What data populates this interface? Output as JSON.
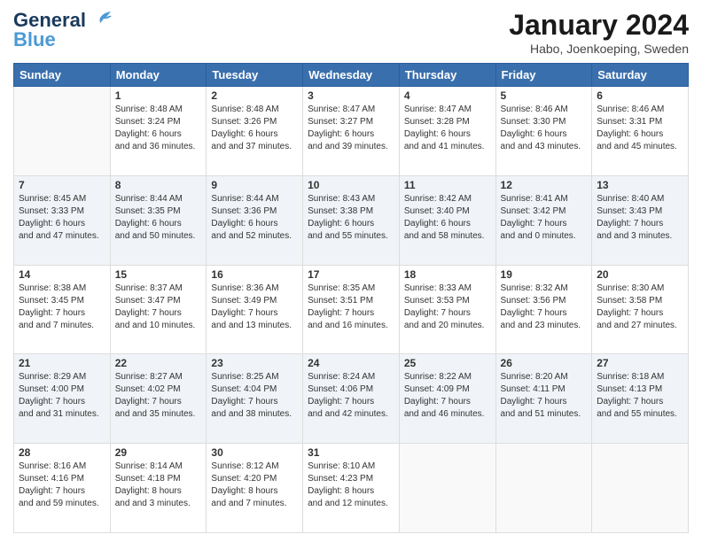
{
  "header": {
    "logo_line1": "General",
    "logo_line2": "Blue",
    "title": "January 2024",
    "subtitle": "Habo, Joenkoeping, Sweden"
  },
  "weekdays": [
    "Sunday",
    "Monday",
    "Tuesday",
    "Wednesday",
    "Thursday",
    "Friday",
    "Saturday"
  ],
  "weeks": [
    [
      {
        "day": "",
        "sunrise": "",
        "sunset": "",
        "daylight": ""
      },
      {
        "day": "1",
        "sunrise": "Sunrise: 8:48 AM",
        "sunset": "Sunset: 3:24 PM",
        "daylight": "Daylight: 6 hours and 36 minutes."
      },
      {
        "day": "2",
        "sunrise": "Sunrise: 8:48 AM",
        "sunset": "Sunset: 3:26 PM",
        "daylight": "Daylight: 6 hours and 37 minutes."
      },
      {
        "day": "3",
        "sunrise": "Sunrise: 8:47 AM",
        "sunset": "Sunset: 3:27 PM",
        "daylight": "Daylight: 6 hours and 39 minutes."
      },
      {
        "day": "4",
        "sunrise": "Sunrise: 8:47 AM",
        "sunset": "Sunset: 3:28 PM",
        "daylight": "Daylight: 6 hours and 41 minutes."
      },
      {
        "day": "5",
        "sunrise": "Sunrise: 8:46 AM",
        "sunset": "Sunset: 3:30 PM",
        "daylight": "Daylight: 6 hours and 43 minutes."
      },
      {
        "day": "6",
        "sunrise": "Sunrise: 8:46 AM",
        "sunset": "Sunset: 3:31 PM",
        "daylight": "Daylight: 6 hours and 45 minutes."
      }
    ],
    [
      {
        "day": "7",
        "sunrise": "Sunrise: 8:45 AM",
        "sunset": "Sunset: 3:33 PM",
        "daylight": "Daylight: 6 hours and 47 minutes."
      },
      {
        "day": "8",
        "sunrise": "Sunrise: 8:44 AM",
        "sunset": "Sunset: 3:35 PM",
        "daylight": "Daylight: 6 hours and 50 minutes."
      },
      {
        "day": "9",
        "sunrise": "Sunrise: 8:44 AM",
        "sunset": "Sunset: 3:36 PM",
        "daylight": "Daylight: 6 hours and 52 minutes."
      },
      {
        "day": "10",
        "sunrise": "Sunrise: 8:43 AM",
        "sunset": "Sunset: 3:38 PM",
        "daylight": "Daylight: 6 hours and 55 minutes."
      },
      {
        "day": "11",
        "sunrise": "Sunrise: 8:42 AM",
        "sunset": "Sunset: 3:40 PM",
        "daylight": "Daylight: 6 hours and 58 minutes."
      },
      {
        "day": "12",
        "sunrise": "Sunrise: 8:41 AM",
        "sunset": "Sunset: 3:42 PM",
        "daylight": "Daylight: 7 hours and 0 minutes."
      },
      {
        "day": "13",
        "sunrise": "Sunrise: 8:40 AM",
        "sunset": "Sunset: 3:43 PM",
        "daylight": "Daylight: 7 hours and 3 minutes."
      }
    ],
    [
      {
        "day": "14",
        "sunrise": "Sunrise: 8:38 AM",
        "sunset": "Sunset: 3:45 PM",
        "daylight": "Daylight: 7 hours and 7 minutes."
      },
      {
        "day": "15",
        "sunrise": "Sunrise: 8:37 AM",
        "sunset": "Sunset: 3:47 PM",
        "daylight": "Daylight: 7 hours and 10 minutes."
      },
      {
        "day": "16",
        "sunrise": "Sunrise: 8:36 AM",
        "sunset": "Sunset: 3:49 PM",
        "daylight": "Daylight: 7 hours and 13 minutes."
      },
      {
        "day": "17",
        "sunrise": "Sunrise: 8:35 AM",
        "sunset": "Sunset: 3:51 PM",
        "daylight": "Daylight: 7 hours and 16 minutes."
      },
      {
        "day": "18",
        "sunrise": "Sunrise: 8:33 AM",
        "sunset": "Sunset: 3:53 PM",
        "daylight": "Daylight: 7 hours and 20 minutes."
      },
      {
        "day": "19",
        "sunrise": "Sunrise: 8:32 AM",
        "sunset": "Sunset: 3:56 PM",
        "daylight": "Daylight: 7 hours and 23 minutes."
      },
      {
        "day": "20",
        "sunrise": "Sunrise: 8:30 AM",
        "sunset": "Sunset: 3:58 PM",
        "daylight": "Daylight: 7 hours and 27 minutes."
      }
    ],
    [
      {
        "day": "21",
        "sunrise": "Sunrise: 8:29 AM",
        "sunset": "Sunset: 4:00 PM",
        "daylight": "Daylight: 7 hours and 31 minutes."
      },
      {
        "day": "22",
        "sunrise": "Sunrise: 8:27 AM",
        "sunset": "Sunset: 4:02 PM",
        "daylight": "Daylight: 7 hours and 35 minutes."
      },
      {
        "day": "23",
        "sunrise": "Sunrise: 8:25 AM",
        "sunset": "Sunset: 4:04 PM",
        "daylight": "Daylight: 7 hours and 38 minutes."
      },
      {
        "day": "24",
        "sunrise": "Sunrise: 8:24 AM",
        "sunset": "Sunset: 4:06 PM",
        "daylight": "Daylight: 7 hours and 42 minutes."
      },
      {
        "day": "25",
        "sunrise": "Sunrise: 8:22 AM",
        "sunset": "Sunset: 4:09 PM",
        "daylight": "Daylight: 7 hours and 46 minutes."
      },
      {
        "day": "26",
        "sunrise": "Sunrise: 8:20 AM",
        "sunset": "Sunset: 4:11 PM",
        "daylight": "Daylight: 7 hours and 51 minutes."
      },
      {
        "day": "27",
        "sunrise": "Sunrise: 8:18 AM",
        "sunset": "Sunset: 4:13 PM",
        "daylight": "Daylight: 7 hours and 55 minutes."
      }
    ],
    [
      {
        "day": "28",
        "sunrise": "Sunrise: 8:16 AM",
        "sunset": "Sunset: 4:16 PM",
        "daylight": "Daylight: 7 hours and 59 minutes."
      },
      {
        "day": "29",
        "sunrise": "Sunrise: 8:14 AM",
        "sunset": "Sunset: 4:18 PM",
        "daylight": "Daylight: 8 hours and 3 minutes."
      },
      {
        "day": "30",
        "sunrise": "Sunrise: 8:12 AM",
        "sunset": "Sunset: 4:20 PM",
        "daylight": "Daylight: 8 hours and 7 minutes."
      },
      {
        "day": "31",
        "sunrise": "Sunrise: 8:10 AM",
        "sunset": "Sunset: 4:23 PM",
        "daylight": "Daylight: 8 hours and 12 minutes."
      },
      {
        "day": "",
        "sunrise": "",
        "sunset": "",
        "daylight": ""
      },
      {
        "day": "",
        "sunrise": "",
        "sunset": "",
        "daylight": ""
      },
      {
        "day": "",
        "sunrise": "",
        "sunset": "",
        "daylight": ""
      }
    ]
  ]
}
